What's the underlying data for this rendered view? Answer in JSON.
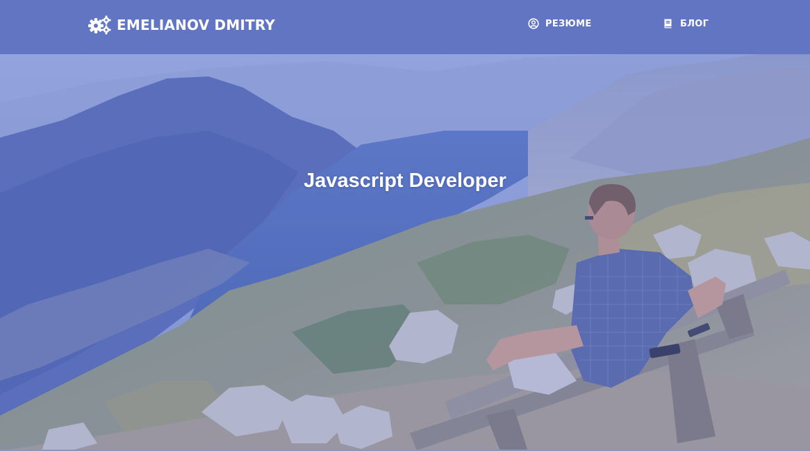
{
  "brand": {
    "name": "EMELIANOV DMITRY",
    "icon": "gears-icon"
  },
  "nav": {
    "items": [
      {
        "label": "РЕЗЮМЕ",
        "icon": "user-circle-icon"
      },
      {
        "label": "БЛОГ",
        "icon": "book-icon"
      }
    ]
  },
  "hero": {
    "title": "Javascript Developer"
  },
  "colors": {
    "navbar": "#6175c2",
    "overlay": "#5a6ec8",
    "text": "#ffffff"
  }
}
